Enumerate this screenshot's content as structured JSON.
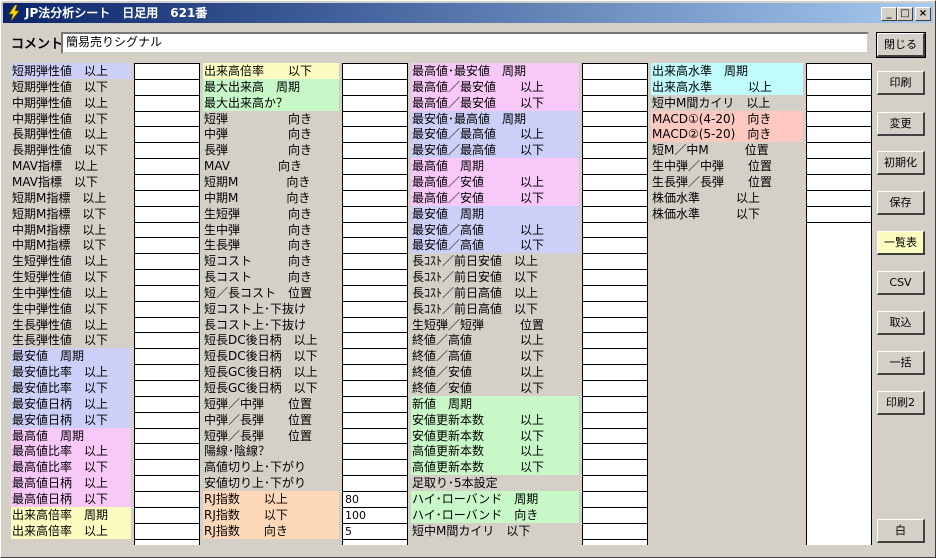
{
  "window": {
    "title": "JP法分析シート　日足用　621番"
  },
  "comment": {
    "label": "コメント",
    "value": "簡易売りシグナル"
  },
  "buttons": {
    "close": "閉じる",
    "print": "印刷",
    "change": "変更",
    "init": "初期化",
    "save": "保存",
    "list": "一覧表",
    "csv": "CSV",
    "import": "取込",
    "batch": "一括",
    "print2": "印刷2",
    "white": "白"
  },
  "colors": {
    "blue": "#ccd0f8",
    "pink": "#f8c8f8",
    "green": "#c8f8c8",
    "yellow": "#fcfcc0",
    "cyan": "#c0fcfc",
    "salmon": "#fcc8c0",
    "orange": "#fcd8b8"
  },
  "columns": [
    {
      "rows": [
        {
          "label": "短期弾性値　以上",
          "color": "blue"
        },
        {
          "label": "短期弾性値　以下",
          "color": ""
        },
        {
          "label": "中期弾性値　以上",
          "color": ""
        },
        {
          "label": "中期弾性値　以下",
          "color": ""
        },
        {
          "label": "長期弾性値　以上",
          "color": ""
        },
        {
          "label": "長期弾性値　以下",
          "color": ""
        },
        {
          "label": "MAV指標　以上",
          "color": ""
        },
        {
          "label": "MAV指標　以下",
          "color": ""
        },
        {
          "label": "短期M指標　以上",
          "color": ""
        },
        {
          "label": "短期M指標　以下",
          "color": ""
        },
        {
          "label": "中期M指標　以上",
          "color": ""
        },
        {
          "label": "中期M指標　以下",
          "color": ""
        },
        {
          "label": "生短弾性値　以上",
          "color": ""
        },
        {
          "label": "生短弾性値　以下",
          "color": ""
        },
        {
          "label": "生中弾性値　以上",
          "color": ""
        },
        {
          "label": "生中弾性値　以下",
          "color": ""
        },
        {
          "label": "生長弾性値　以上",
          "color": ""
        },
        {
          "label": "生長弾性値　以下",
          "color": ""
        },
        {
          "label": "最安値　周期",
          "color": "blue"
        },
        {
          "label": "最安値比率　以上",
          "color": "blue"
        },
        {
          "label": "最安値比率　以下",
          "color": "blue"
        },
        {
          "label": "最安値日柄　以上",
          "color": "blue"
        },
        {
          "label": "最安値日柄　以下",
          "color": "blue"
        },
        {
          "label": "最高値　周期",
          "color": "pink"
        },
        {
          "label": "最高値比率　以上",
          "color": "pink"
        },
        {
          "label": "最高値比率　以下",
          "color": "pink"
        },
        {
          "label": "最高値日柄　以上",
          "color": "pink"
        },
        {
          "label": "最高値日柄　以下",
          "color": "pink"
        },
        {
          "label": "出来高倍率　周期",
          "color": "yellow"
        },
        {
          "label": "出来高倍率　以上",
          "color": "yellow"
        }
      ],
      "values": [
        "",
        "",
        "",
        "",
        "",
        "",
        "",
        "",
        "",
        "",
        "",
        "",
        "",
        "",
        "",
        "",
        "",
        "",
        "",
        "",
        "",
        "",
        "",
        "",
        "",
        "",
        "",
        "",
        "",
        ""
      ]
    },
    {
      "rows": [
        {
          "label": "出来高倍率　　以下",
          "color": "yellow"
        },
        {
          "label": "最大出来高　周期",
          "color": "green"
        },
        {
          "label": "最大出来高か？",
          "color": "green"
        },
        {
          "label": "短弾　　　　　向き",
          "color": ""
        },
        {
          "label": "中弾　　　　　向き",
          "color": ""
        },
        {
          "label": "長弾　　　　　向き",
          "color": ""
        },
        {
          "label": "MAV　　　　向き",
          "color": ""
        },
        {
          "label": "短期M　　　　向き",
          "color": ""
        },
        {
          "label": "中期M　　　　向き",
          "color": ""
        },
        {
          "label": "生短弾　　　　向き",
          "color": ""
        },
        {
          "label": "生中弾　　　　向き",
          "color": ""
        },
        {
          "label": "生長弾　　　　向き",
          "color": ""
        },
        {
          "label": "短コスト　　　向き",
          "color": ""
        },
        {
          "label": "長コスト　　　向き",
          "color": ""
        },
        {
          "label": "短／長コスト　位置",
          "color": ""
        },
        {
          "label": "短コスト上･下抜け",
          "color": ""
        },
        {
          "label": "長コスト上･下抜け",
          "color": ""
        },
        {
          "label": "短長DC後日柄　以上",
          "color": ""
        },
        {
          "label": "短長DC後日柄　以下",
          "color": ""
        },
        {
          "label": "短長GC後日柄　以上",
          "color": ""
        },
        {
          "label": "短長GC後日柄　以下",
          "color": ""
        },
        {
          "label": "短弾／中弾　　位置",
          "color": ""
        },
        {
          "label": "中弾／長弾　　位置",
          "color": ""
        },
        {
          "label": "短弾／長弾　　位置",
          "color": ""
        },
        {
          "label": "陽線･陰線？",
          "color": ""
        },
        {
          "label": "高値切り上･下がり",
          "color": ""
        },
        {
          "label": "安値切り上･下がり",
          "color": ""
        },
        {
          "label": "RJ指数　　以上",
          "color": "orange"
        },
        {
          "label": "RJ指数　　以下",
          "color": "orange"
        },
        {
          "label": "RJ指数　　向き",
          "color": "orange"
        }
      ],
      "values": [
        "",
        "",
        "",
        "",
        "",
        "",
        "",
        "",
        "",
        "",
        "",
        "",
        "",
        "",
        "",
        "",
        "",
        "",
        "",
        "",
        "",
        "",
        "",
        "",
        "",
        "",
        "",
        "80",
        "100",
        "5"
      ]
    },
    {
      "rows": [
        {
          "label": "最高値･最安値　周期",
          "color": "pink"
        },
        {
          "label": "最高値／最安値　　以上",
          "color": "pink"
        },
        {
          "label": "最高値／最安値　　以下",
          "color": "pink"
        },
        {
          "label": "最安値･最高値　周期",
          "color": "blue"
        },
        {
          "label": "最安値／最高値　　以上",
          "color": "blue"
        },
        {
          "label": "最安値／最高値　　以下",
          "color": "blue"
        },
        {
          "label": "最高値　周期",
          "color": "pink"
        },
        {
          "label": "最高値／安値　　　以上",
          "color": "pink"
        },
        {
          "label": "最高値／安値　　　以下",
          "color": "pink"
        },
        {
          "label": "最安値　周期",
          "color": "blue"
        },
        {
          "label": "最安値／高値　　　以上",
          "color": "blue"
        },
        {
          "label": "最安値／高値　　　以下",
          "color": "blue"
        },
        {
          "label": "長ｺｽﾄ／前日安値　以上",
          "color": ""
        },
        {
          "label": "長ｺｽﾄ／前日安値　以下",
          "color": ""
        },
        {
          "label": "長ｺｽﾄ／前日高値　以上",
          "color": ""
        },
        {
          "label": "長ｺｽﾄ／前日高値　以下",
          "color": ""
        },
        {
          "label": "生短弾／短弾　　　位置",
          "color": ""
        },
        {
          "label": "終値／高値　　　　以上",
          "color": ""
        },
        {
          "label": "終値／高値　　　　以下",
          "color": ""
        },
        {
          "label": "終値／安値　　　　以上",
          "color": ""
        },
        {
          "label": "終値／安値　　　　以下",
          "color": ""
        },
        {
          "label": "新値　周期",
          "color": "green"
        },
        {
          "label": "安値更新本数　　　以上",
          "color": "green"
        },
        {
          "label": "安値更新本数　　　以下",
          "color": "green"
        },
        {
          "label": "高値更新本数　　　以上",
          "color": "green"
        },
        {
          "label": "高値更新本数　　　以下",
          "color": "green"
        },
        {
          "label": "足取り･5本設定",
          "color": ""
        },
        {
          "label": "ハイ･ローバンド　周期",
          "color": "green"
        },
        {
          "label": "ハイ･ローバンド　向き",
          "color": "green"
        },
        {
          "label": "短中M間カイリ　以下",
          "color": ""
        }
      ],
      "values": [
        "",
        "",
        "",
        "",
        "",
        "",
        "",
        "",
        "",
        "",
        "",
        "",
        "",
        "",
        "",
        "",
        "",
        "",
        "",
        "",
        "",
        "",
        "",
        "",
        "",
        "",
        "",
        "",
        "",
        ""
      ]
    },
    {
      "rows": [
        {
          "label": "出来高水準　周期",
          "color": "cyan"
        },
        {
          "label": "出来高水準　　　以上",
          "color": "cyan"
        },
        {
          "label": "短中M間カイリ　以上",
          "color": ""
        },
        {
          "label": "MACD①(4-20)　向き",
          "color": "salmon"
        },
        {
          "label": "MACD②(5-20)　向き",
          "color": "salmon"
        },
        {
          "label": "短M／中M　　　位置",
          "color": ""
        },
        {
          "label": "生中弾／中弾　　位置",
          "color": ""
        },
        {
          "label": "生長弾／長弾　　位置",
          "color": ""
        },
        {
          "label": "株価水準　　　以上",
          "color": ""
        },
        {
          "label": "株価水準　　　以下",
          "color": ""
        }
      ],
      "values": [
        "",
        "",
        "",
        "",
        "",
        "",
        "",
        "",
        "",
        ""
      ]
    }
  ]
}
